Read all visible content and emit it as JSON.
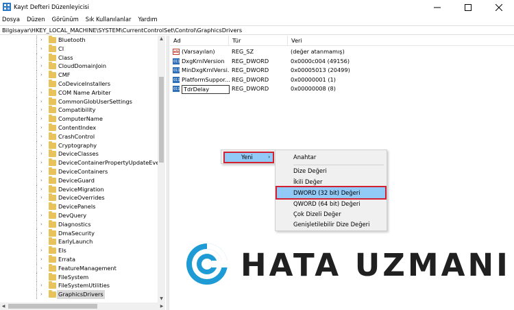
{
  "window": {
    "title": "Kayıt Defteri Düzenleyicisi"
  },
  "menu": [
    "Dosya",
    "Düzen",
    "Görünüm",
    "Sık Kullanılanlar",
    "Yardım"
  ],
  "address": "Bilgisayar\\HKEY_LOCAL_MACHINE\\SYSTEM\\CurrentControlSet\\Control\\GraphicsDrivers",
  "tree": [
    {
      "label": "Bluetooth",
      "expandable": true
    },
    {
      "label": "CI",
      "expandable": true
    },
    {
      "label": "Class",
      "expandable": true
    },
    {
      "label": "CloudDomainJoin",
      "expandable": true
    },
    {
      "label": "CMF",
      "expandable": true
    },
    {
      "label": "CoDeviceInstallers",
      "expandable": false
    },
    {
      "label": "COM Name Arbiter",
      "expandable": true
    },
    {
      "label": "CommonGlobUserSettings",
      "expandable": true
    },
    {
      "label": "Compatibility",
      "expandable": true
    },
    {
      "label": "ComputerName",
      "expandable": true
    },
    {
      "label": "ContentIndex",
      "expandable": true
    },
    {
      "label": "CrashControl",
      "expandable": true
    },
    {
      "label": "Cryptography",
      "expandable": true
    },
    {
      "label": "DeviceClasses",
      "expandable": true
    },
    {
      "label": "DeviceContainerPropertyUpdateEvents",
      "expandable": true
    },
    {
      "label": "DeviceContainers",
      "expandable": true
    },
    {
      "label": "DeviceGuard",
      "expandable": true
    },
    {
      "label": "DeviceMigration",
      "expandable": true
    },
    {
      "label": "DeviceOverrides",
      "expandable": true
    },
    {
      "label": "DevicePanels",
      "expandable": false
    },
    {
      "label": "DevQuery",
      "expandable": true
    },
    {
      "label": "Diagnostics",
      "expandable": true
    },
    {
      "label": "DmaSecurity",
      "expandable": true
    },
    {
      "label": "EarlyLaunch",
      "expandable": false
    },
    {
      "label": "Els",
      "expandable": true
    },
    {
      "label": "Errata",
      "expandable": true
    },
    {
      "label": "FeatureManagement",
      "expandable": true
    },
    {
      "label": "FileSystem",
      "expandable": false
    },
    {
      "label": "FileSystemUtilities",
      "expandable": true
    },
    {
      "label": "GraphicsDrivers",
      "expandable": true,
      "selected": true
    }
  ],
  "columns": {
    "name": "Ad",
    "type": "Tür",
    "data": "Veri"
  },
  "values": [
    {
      "icon": "ab",
      "kind": "sz",
      "name": "(Varsayılan)",
      "type": "REG_SZ",
      "data": "(değer atanmamış)"
    },
    {
      "icon": "011",
      "kind": "dw",
      "name": "DxgKrnlVersion",
      "type": "REG_DWORD",
      "data": "0x0000c004 (49156)"
    },
    {
      "icon": "011",
      "kind": "dw",
      "name": "MinDxgKrnlVersi...",
      "type": "REG_DWORD",
      "data": "0x00005013 (20499)"
    },
    {
      "icon": "011",
      "kind": "dw",
      "name": "PlatformSuppor...",
      "type": "REG_DWORD",
      "data": "0x00000001 (1)"
    },
    {
      "icon": "011",
      "kind": "dw",
      "name": "TdrDelay",
      "type": "REG_DWORD",
      "data": "0x00000008 (8)",
      "editing": true
    }
  ],
  "context_menu": {
    "new_label": "Yeni"
  },
  "submenu": {
    "key": "Anahtar",
    "string": "Dize Değeri",
    "binary": "İkili Değer",
    "dword": "DWORD (32 bit) Değeri",
    "qword": "QWORD (64 bit) Değeri",
    "multi": "Çok Dizeli Değer",
    "expand": "Genişletilebilir Dize Değeri"
  },
  "watermark": {
    "text": "HATA UZMANI"
  },
  "colors": {
    "highlight": "#91c9f7",
    "annotation": "#d32031",
    "folder": "#e8c25a",
    "dword_icon": "#2f6fb5"
  }
}
